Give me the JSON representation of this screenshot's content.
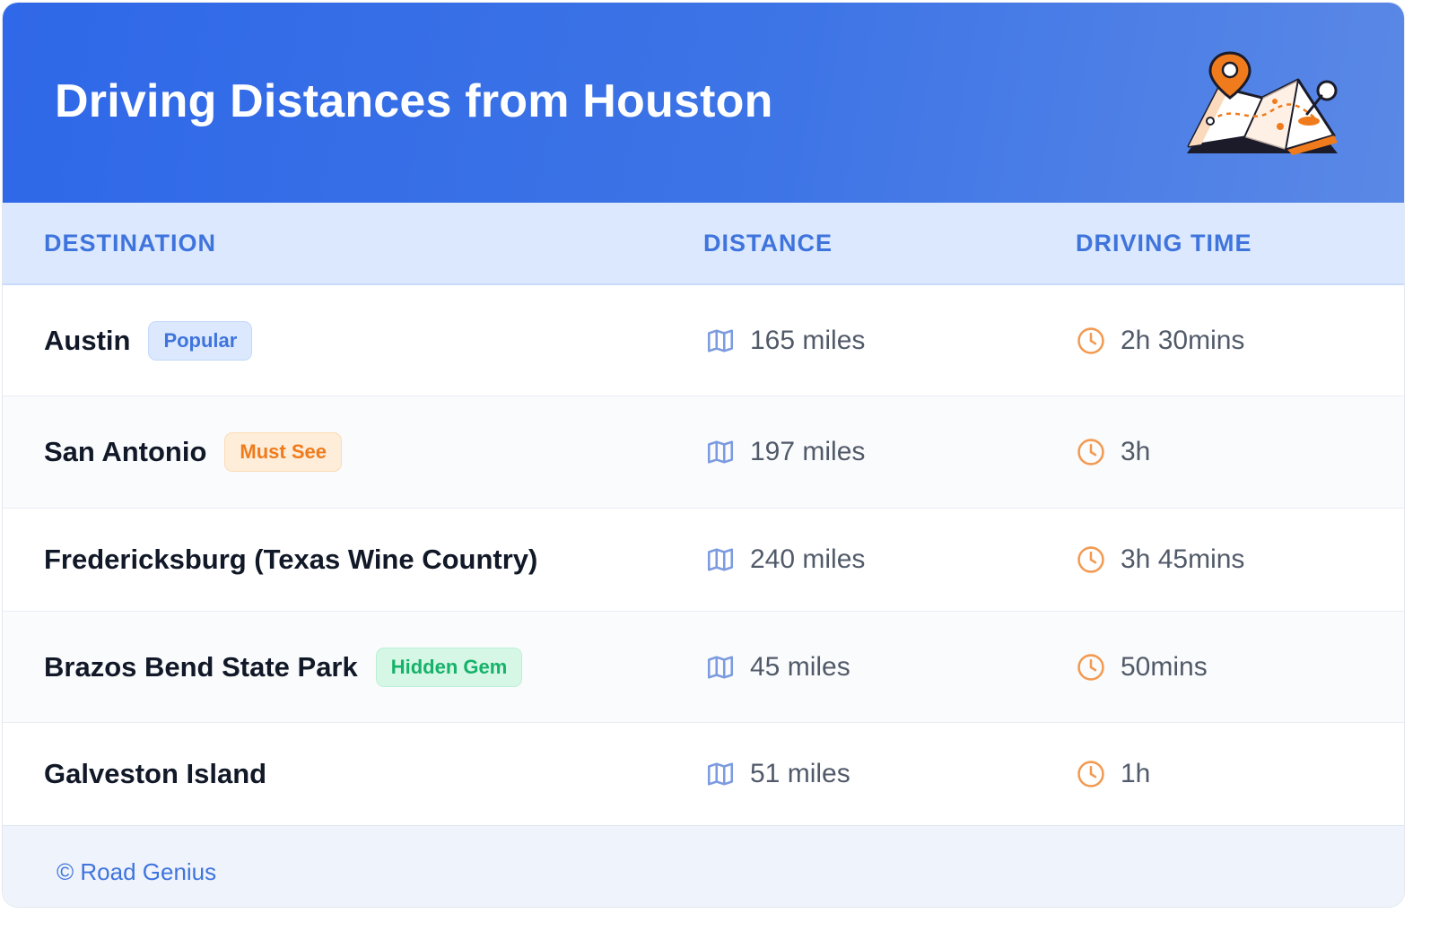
{
  "header": {
    "title": "Driving Distances from Houston",
    "illustration": "map-with-pins-illustration"
  },
  "table": {
    "columns": [
      "DESTINATION",
      "DISTANCE",
      "DRIVING TIME"
    ],
    "rows": [
      {
        "destination": "Austin",
        "badge": "Popular",
        "badge_color": "#3f74dd",
        "distance": "165 miles",
        "time": "2h 30mins"
      },
      {
        "destination": "San Antonio",
        "badge": "Must See",
        "badge_color": "#f07b1c",
        "distance": "197 miles",
        "time": "3h"
      },
      {
        "destination": "Fredericksburg (Texas Wine Country)",
        "badge": "",
        "badge_color": "",
        "distance": "240 miles",
        "time": "3h 45mins"
      },
      {
        "destination": "Brazos Bend State Park",
        "badge": "Hidden Gem",
        "badge_color": "#17b26a",
        "distance": "45 miles",
        "time": "50mins"
      },
      {
        "destination": "Galveston Island",
        "badge": "",
        "badge_color": "",
        "distance": "51 miles",
        "time": "1h"
      }
    ],
    "distance_icon": "map-icon",
    "time_icon": "clock-icon"
  },
  "footer": {
    "credit": "© Road Genius"
  },
  "colors": {
    "header_bg": "#2f68e8",
    "accent_blue": "#3f74dd",
    "accent_orange": "#f07b1c",
    "accent_green": "#17b26a"
  }
}
